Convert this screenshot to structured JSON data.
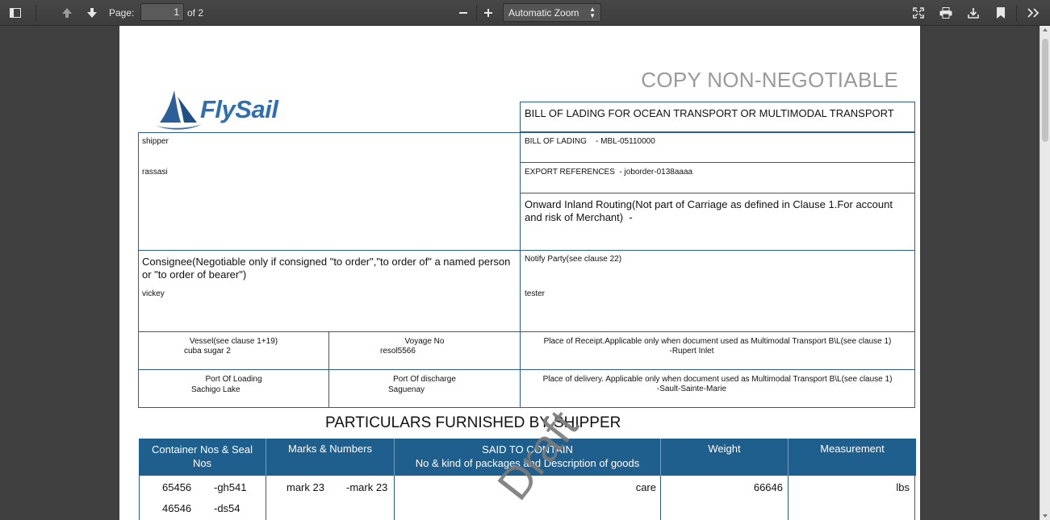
{
  "toolbar": {
    "page_label": "Page:",
    "page_value": "1",
    "page_of": "of 2",
    "zoom_value": "Automatic Zoom",
    "icons": [
      "sidebar-toggle-icon",
      "previous-page-icon",
      "next-page-icon",
      "zoom-out-icon",
      "zoom-in-icon",
      "presentation-mode-icon",
      "print-icon",
      "download-icon",
      "bookmark-icon",
      "tools-icon"
    ]
  },
  "document": {
    "copy_title": "COPY NON-NEGOTIABLE",
    "logo_text": "FlySail",
    "bol_title": "BILL OF LADING FOR OCEAN TRANSPORT OR MULTIMODAL TRANSPORT",
    "bol_number_label": "BILL OF LADING",
    "bol_number_value": "- MBL-05110000",
    "export_ref_label": "EXPORT REFERENCES",
    "export_ref_value": "- joborder-0138aaaa",
    "routing_label": "Onward Inland Routing(Not part of Carriage as defined in Clause 1.For account and risk of Merchant)",
    "routing_value": "-",
    "shipper_label": "shipper",
    "shipper_value": "rassasi",
    "consignee_label": "Consignee(Negotiable only if consigned \"to order\",\"to order of\" a named person or \"to order of bearer\")",
    "consignee_value": "vickey",
    "notify_label": "Notify Party(see clause 22)",
    "notify_value": "tester",
    "vessel_label": "Vessel(see clause 1+19)",
    "vessel_value": "cuba sugar 2",
    "voyage_label": "Voyage No",
    "voyage_value": "resol5566",
    "receipt_label": "Place of Receipt.Applicable only when document used as Multimodal Transport B\\L(see clause 1)",
    "receipt_value": "-Rupert Inlet",
    "loading_label": "Port Of Loading",
    "loading_value": "Sachigo Lake",
    "discharge_label": "Port Of discharge",
    "discharge_value": "Saguenay",
    "delivery_label": "Place of delivery. Applicable only when document used as Multimodal Transport B\\L(see clause 1)",
    "delivery_value": "-Sault-Sainte-Marie",
    "particulars_title": "PARTICULARS FURNISHED BY SHIPPER",
    "columns": {
      "container": "Container Nos & Seal Nos",
      "marks": "Marks & Numbers",
      "said_line1": "SAID TO CONTAIN",
      "said_line2": "No & kind of packages and Description of goods",
      "weight": "Weight",
      "measurement": "Measurement"
    },
    "rows": {
      "c1a": "65456",
      "c1b": "-gh541",
      "c2a": "46546",
      "c2b": "-ds54",
      "m1a": "mark 23",
      "m1b": "-mark 23",
      "desc": "care",
      "weight": "66646",
      "measure": "lbs"
    },
    "watermark": "Draft"
  }
}
